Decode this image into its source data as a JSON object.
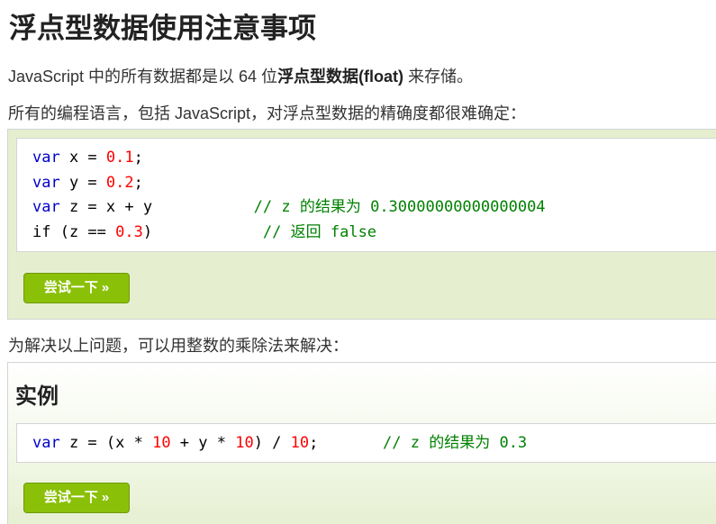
{
  "heading": "浮点型数据使用注意事项",
  "intro": {
    "before": "JavaScript 中的所有数据都是以 64 位",
    "bold": "浮点型数据(float)",
    "after": " 来存储。"
  },
  "para2": "所有的编程语言，包括 JavaScript，对浮点型数据的精确度都很难确定：",
  "example1": {
    "code": {
      "l1": {
        "kw": "var",
        "plain": " x = ",
        "num": "0.1",
        "end": ";"
      },
      "l2": {
        "kw": "var",
        "plain": " y = ",
        "num": "0.2",
        "end": ";"
      },
      "l3": {
        "kw": "var",
        "plain": " z = x + y           ",
        "comment_prefix": "// z 的结果为 ",
        "comment_value": "0.30000000000000004"
      },
      "l4": {
        "plain": "if (z == ",
        "num": "0.3",
        "end": ")            ",
        "comment_prefix": "// 返回 ",
        "comment_value": "false"
      }
    },
    "try_button": "尝试一下 »"
  },
  "para3": "为解决以上问题，可以用整数的乘除法来解决：",
  "example2": {
    "title": "实例",
    "code": {
      "kw": "var",
      "p1": " z = (x * ",
      "n1": "10",
      "p2": " + y * ",
      "n2": "10",
      "p3": ") / ",
      "n3": "10",
      "p4": ";       ",
      "comment_prefix": "// z 的结果为 ",
      "comment_value": "0.3"
    },
    "try_button": "尝试一下 »"
  },
  "colors": {
    "keyword": "#0000cd",
    "number": "#ff0000",
    "comment": "#008000",
    "button": "#8ac007",
    "example_bg": "#e5efcf"
  }
}
